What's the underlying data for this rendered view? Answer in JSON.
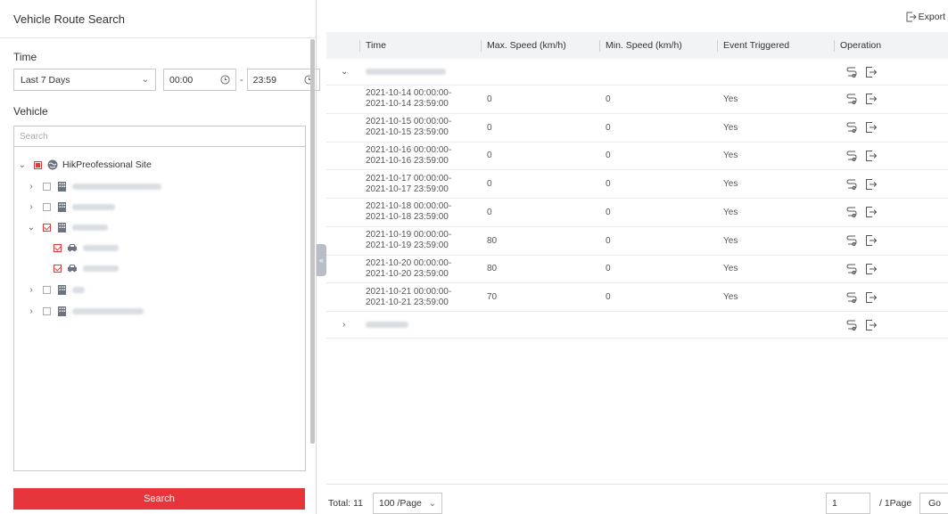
{
  "left_panel": {
    "title": "Vehicle Route Search",
    "time_label": "Time",
    "time_range": "Last 7 Days",
    "start_time": "00:00",
    "end_time": "23:59",
    "vehicle_label": "Vehicle",
    "search_placeholder": "Search",
    "tree": {
      "root_label": "HikPreofessional Site",
      "groups": [
        {
          "expanded": false,
          "checked": false
        },
        {
          "expanded": false,
          "checked": false
        },
        {
          "expanded": true,
          "checked": true,
          "children": [
            {
              "checked": true
            },
            {
              "checked": true
            }
          ]
        },
        {
          "expanded": false,
          "checked": false
        },
        {
          "expanded": false,
          "checked": false
        }
      ]
    },
    "search_button": "Search",
    "collapse_glyph": "«"
  },
  "right_panel": {
    "export_label": "Export",
    "columns": [
      "Time",
      "Max. Speed (km/h)",
      "Min. Speed (km/h)",
      "Event Triggered",
      "Operation"
    ],
    "rows": [
      {
        "start": "2021-10-14 00:00:00-",
        "end": "2021-10-14 23:59:00",
        "max": "0",
        "min": "0",
        "event": "Yes"
      },
      {
        "start": "2021-10-15 00:00:00-",
        "end": "2021-10-15 23:59:00",
        "max": "0",
        "min": "0",
        "event": "Yes"
      },
      {
        "start": "2021-10-16 00:00:00-",
        "end": "2021-10-16 23:59:00",
        "max": "0",
        "min": "0",
        "event": "Yes"
      },
      {
        "start": "2021-10-17 00:00:00-",
        "end": "2021-10-17 23:59:00",
        "max": "0",
        "min": "0",
        "event": "Yes"
      },
      {
        "start": "2021-10-18 00:00:00-",
        "end": "2021-10-18 23:59:00",
        "max": "0",
        "min": "0",
        "event": "Yes"
      },
      {
        "start": "2021-10-19 00:00:00-",
        "end": "2021-10-19 23:59:00",
        "max": "80",
        "min": "0",
        "event": "Yes"
      },
      {
        "start": "2021-10-20 00:00:00-",
        "end": "2021-10-20 23:59:00",
        "max": "80",
        "min": "0",
        "event": "Yes"
      },
      {
        "start": "2021-10-21 00:00:00-",
        "end": "2021-10-21 23:59:00",
        "max": "70",
        "min": "0",
        "event": "Yes"
      }
    ],
    "pagination": {
      "total": "Total: 11",
      "per_page": "100 /Page",
      "current_page": "1",
      "page_total": "/ 1Page",
      "go_label": "Go"
    }
  },
  "colors": {
    "accent": "#e8353b",
    "header_bg": "#f2f3f5",
    "border": "#c9c9c9"
  }
}
